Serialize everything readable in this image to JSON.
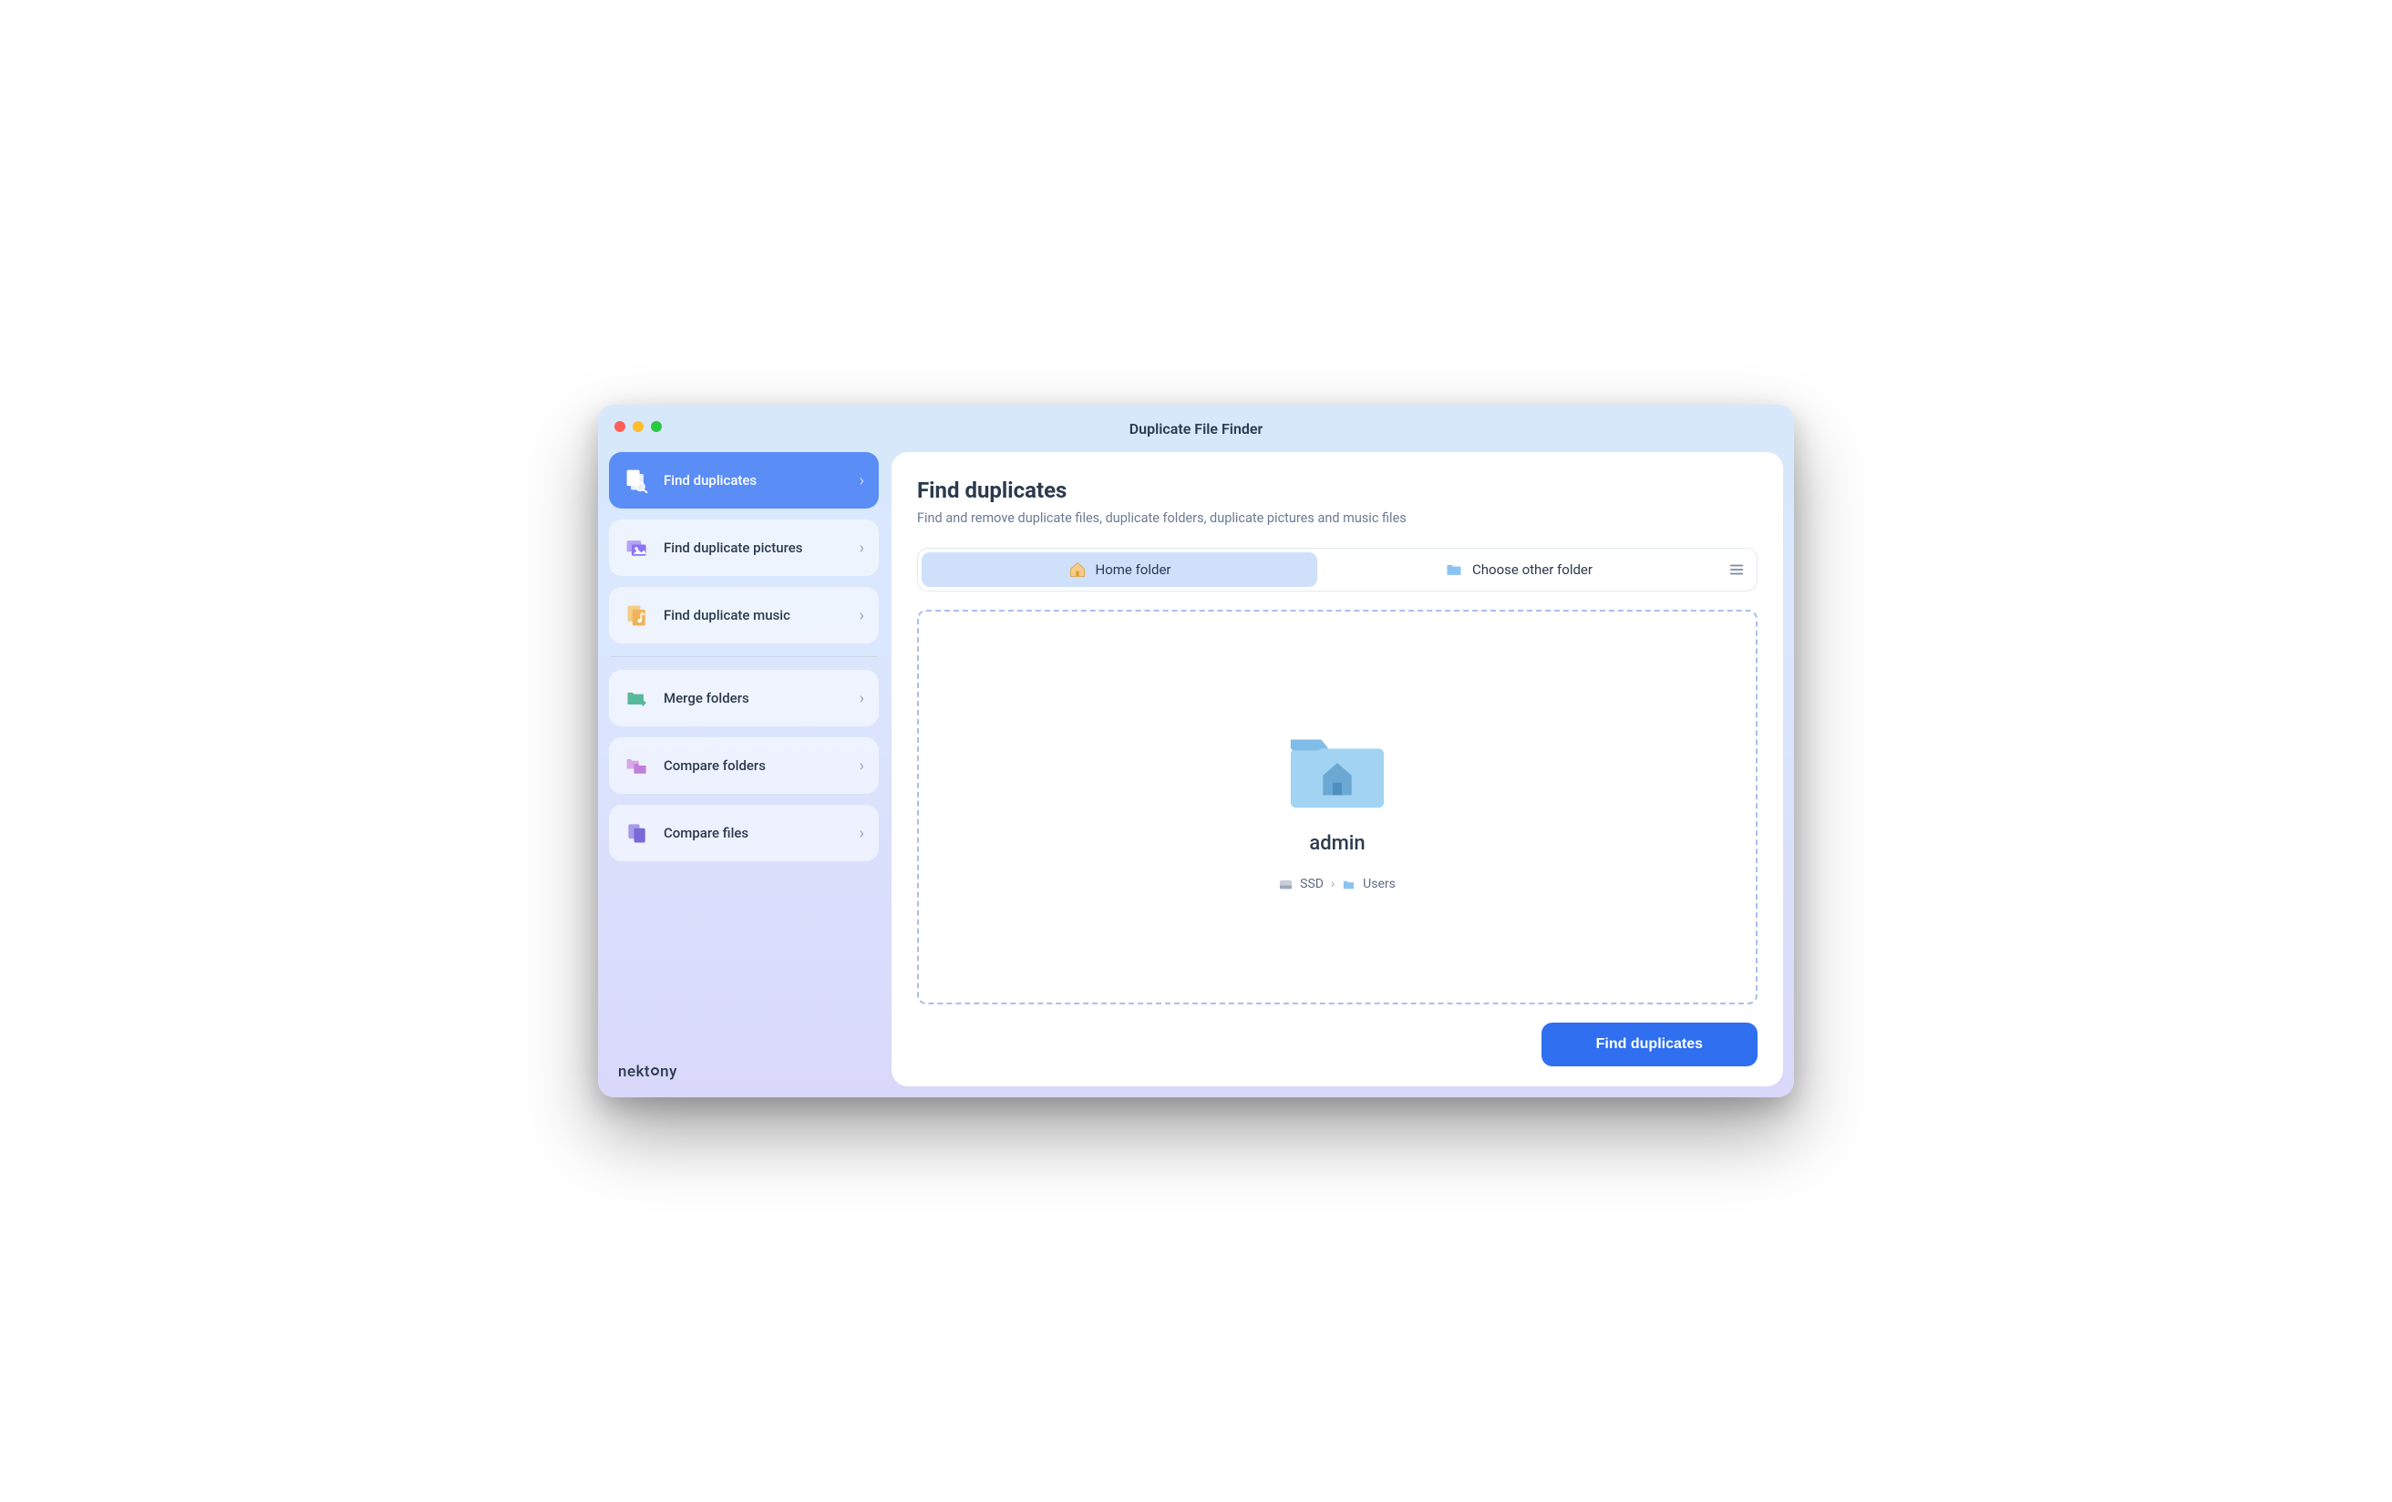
{
  "window": {
    "title": "Duplicate File Finder"
  },
  "brand": "nektony",
  "sidebar": {
    "group1": [
      {
        "label": "Find duplicates"
      },
      {
        "label": "Find duplicate pictures"
      },
      {
        "label": "Find duplicate music"
      }
    ],
    "group2": [
      {
        "label": "Merge folders"
      },
      {
        "label": "Compare folders"
      },
      {
        "label": "Compare files"
      }
    ]
  },
  "main": {
    "heading": "Find duplicates",
    "subtitle": "Find and remove duplicate files, duplicate folders, duplicate pictures and music files",
    "tabs": {
      "home": "Home folder",
      "other": "Choose other folder"
    },
    "selected_folder": {
      "name": "admin",
      "path_drive": "SSD",
      "path_parent": "Users"
    },
    "action_button": "Find duplicates"
  }
}
